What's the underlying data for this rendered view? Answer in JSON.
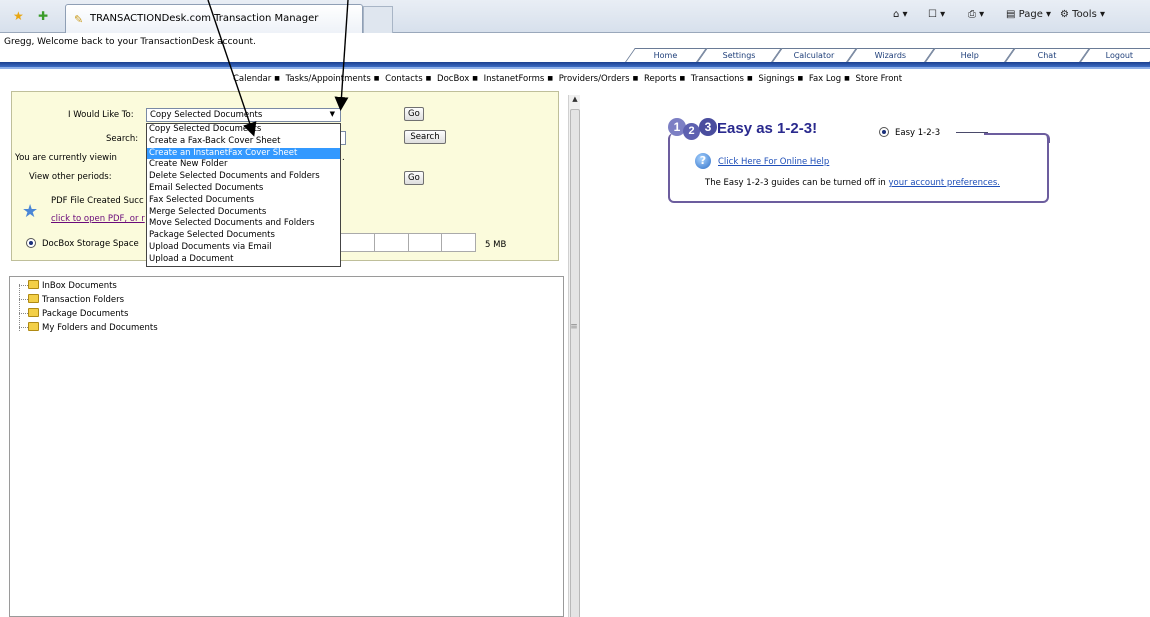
{
  "browser": {
    "tab_title": "TRANSACTIONDesk.com Transaction Manager",
    "commands": {
      "page": "Page",
      "tools": "Tools"
    }
  },
  "welcome_text": "Gregg, Welcome back to your TransactionDesk account.",
  "nav_tabs": [
    "Home",
    "Settings",
    "Calculator",
    "Wizards",
    "Help",
    "Chat",
    "Logout"
  ],
  "links": [
    "Calendar",
    "Tasks/Appointments",
    "Contacts",
    "DocBox",
    "InstanetForms",
    "Providers/Orders",
    "Reports",
    "Transactions",
    "Signings",
    "Fax Log",
    "Store Front"
  ],
  "panel": {
    "would_like_label": "I Would Like To:",
    "selected_action": "Copy Selected Documents",
    "go_label": "Go",
    "search_label": "Search:",
    "search_button": "Search",
    "viewing_label": "You are currently viewin",
    "other_periods_label": "View other periods:",
    "go2_label": "Go",
    "pdf_created": "PDF File Created Succ",
    "pdf_link": "click to open PDF, or r",
    "storage_label": "DocBox Storage Space",
    "storage_value": "5 MB"
  },
  "dropdown_options": [
    "Copy Selected Documents",
    "Create a Fax-Back Cover Sheet",
    "Create an InstanetFax Cover Sheet",
    "Create New Folder",
    "Delete Selected Documents and Folders",
    "Email Selected Documents",
    "Fax Selected Documents",
    "Merge Selected Documents",
    "Move Selected Documents and Folders",
    "Package Selected Documents",
    "Upload Documents via Email",
    "Upload a Document"
  ],
  "highlighted_option": "Create an InstanetFax Cover Sheet",
  "tree": [
    "InBox Documents",
    "Transaction Folders",
    "Package Documents",
    "My Folders and Documents"
  ],
  "easy": {
    "numbers": [
      "1",
      "2",
      "3"
    ],
    "title": "Easy as 1-2-3!",
    "radio_label": "Easy 1-2-3",
    "help_link": "Click Here For Online Help",
    "guide_text": "The Easy 1-2-3 guides can be turned off in ",
    "pref_link": "your account preferences."
  },
  "colors": {
    "nav_blue": "#1b3f8f",
    "panel_bg": "#fbfbdc",
    "highlight": "#3399ff",
    "easy_border": "#6c5d9e"
  }
}
